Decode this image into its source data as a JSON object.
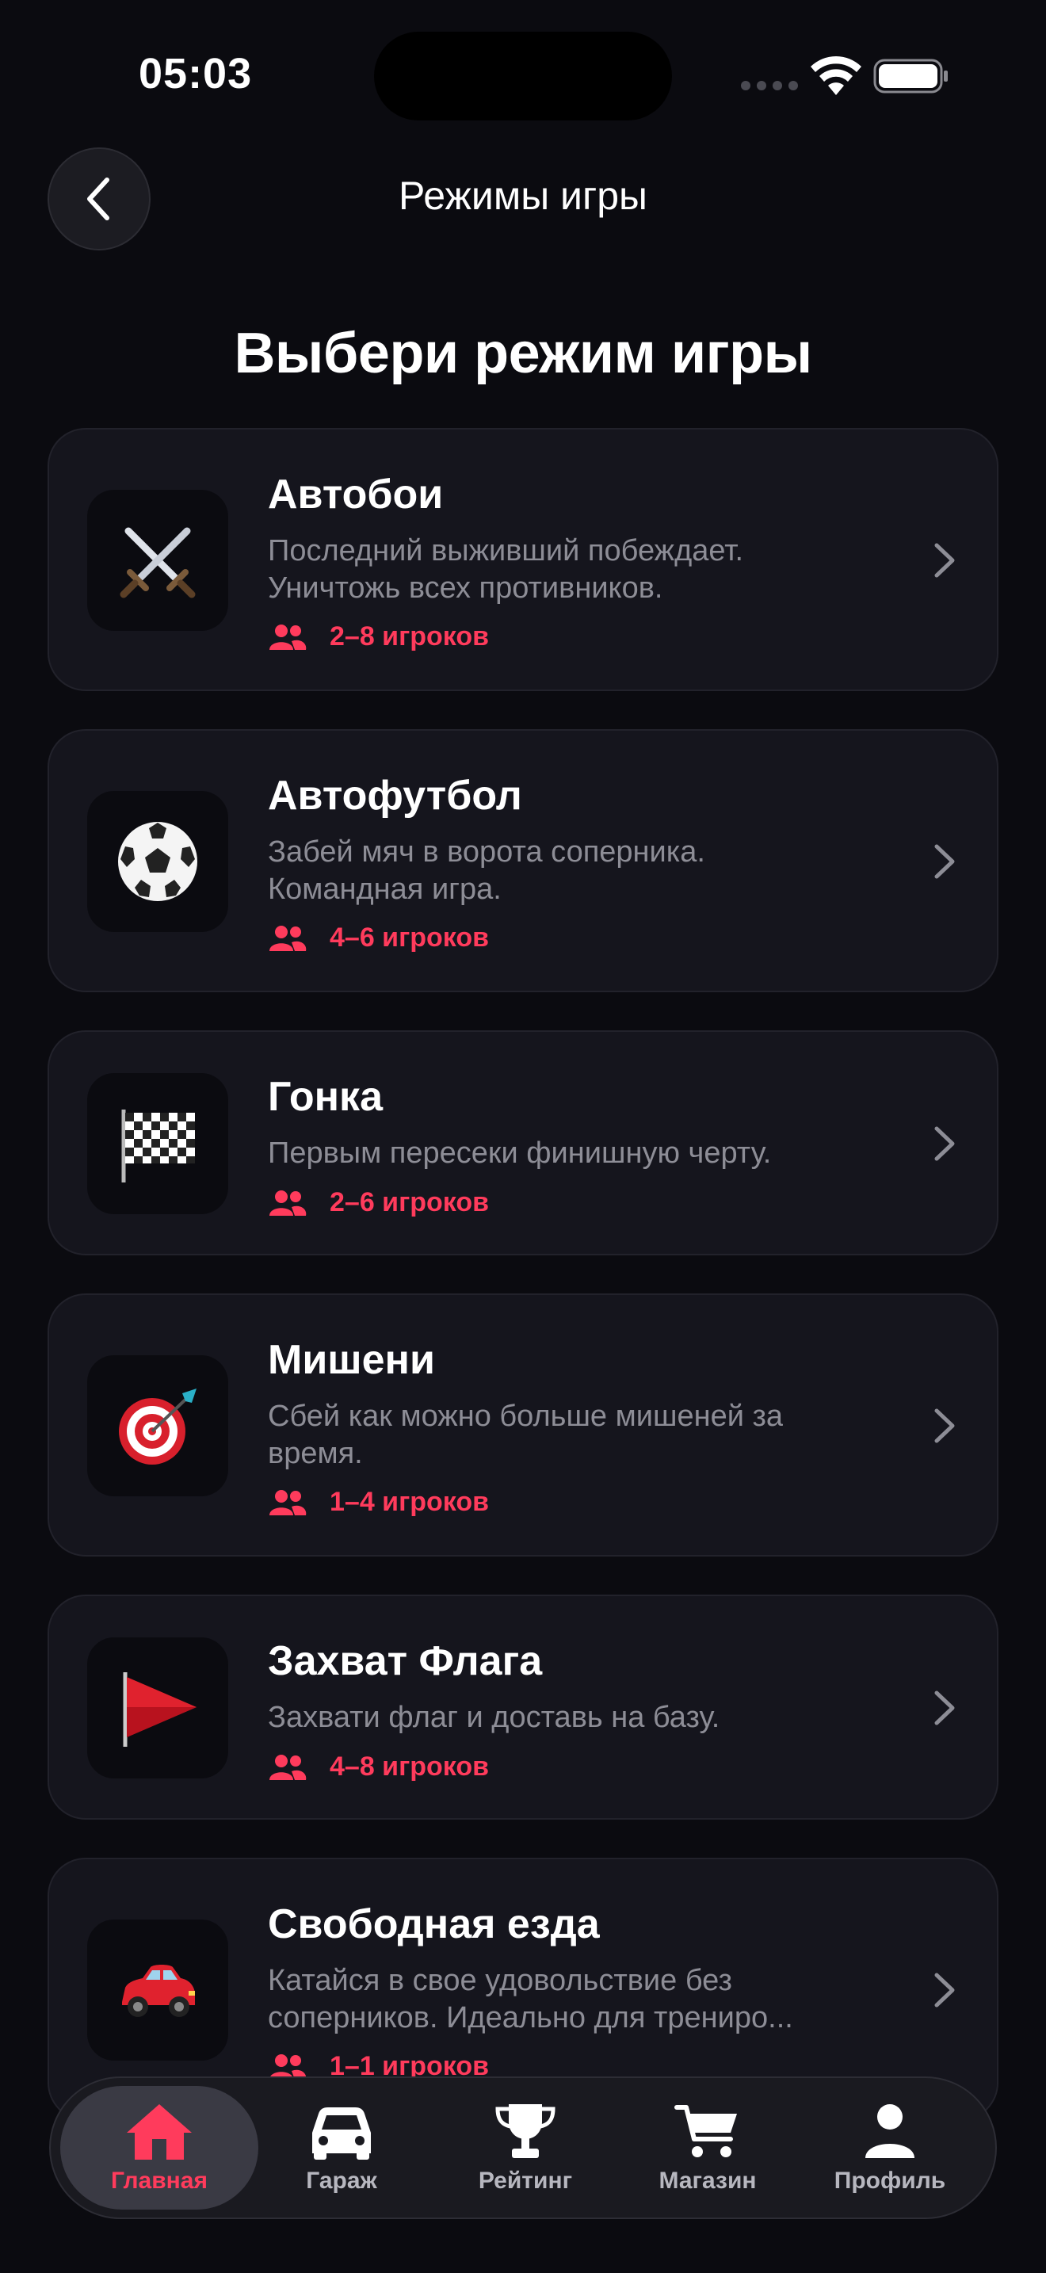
{
  "status_bar": {
    "time": "05:03"
  },
  "header": {
    "title": "Режимы игры"
  },
  "heading": "Выбери режим игры",
  "modes": [
    {
      "title": "Автобои",
      "desc": "Последний выживший побеждает. Уничтожь всех противников.",
      "players": "2–8 игроков",
      "icon": "crossed-swords-icon"
    },
    {
      "title": "Автофутбол",
      "desc": "Забей мяч в ворота соперника. Командная игра.",
      "players": "4–6 игроков",
      "icon": "soccer-ball-icon"
    },
    {
      "title": "Гонка",
      "desc": "Первым пересеки финишную черту.",
      "players": "2–6 игроков",
      "icon": "checkered-flag-icon"
    },
    {
      "title": "Мишени",
      "desc": "Сбей как можно больше мишеней за время.",
      "players": "1–4 игроков",
      "icon": "target-dart-icon"
    },
    {
      "title": "Захват Флага",
      "desc": "Захвати флаг и доставь на базу.",
      "players": "4–8 игроков",
      "icon": "red-flag-icon"
    },
    {
      "title": "Свободная езда",
      "desc": "Катайся в свое удовольствие без соперников. Идеально для трениро...",
      "players": "1–1 игроков",
      "icon": "red-car-icon"
    }
  ],
  "tabs": [
    {
      "label": "Главная",
      "icon": "home-icon",
      "active": true
    },
    {
      "label": "Гараж",
      "icon": "car-icon",
      "active": false
    },
    {
      "label": "Рейтинг",
      "icon": "trophy-icon",
      "active": false
    },
    {
      "label": "Магазин",
      "icon": "cart-icon",
      "active": false
    },
    {
      "label": "Профиль",
      "icon": "profile-icon",
      "active": false
    }
  ],
  "colors": {
    "accent": "#ff3b5c",
    "background": "#0b0b10",
    "card": "#15151d"
  }
}
